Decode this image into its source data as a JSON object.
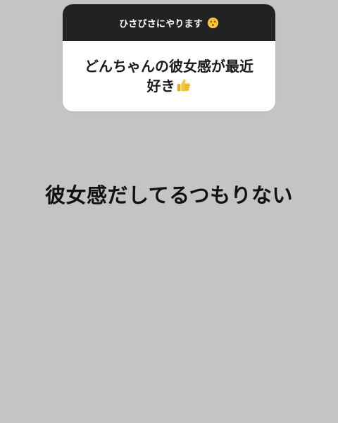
{
  "question_sticker": {
    "prompt": "ひさびさにやります",
    "prompt_emoji": "kissing-face-icon",
    "answer": "どんちゃんの彼女感が最近好き",
    "answer_emoji": "thumbs-up-icon"
  },
  "caption": "彼女感だしてるつもりない",
  "colors": {
    "background": "#c4c4c4",
    "sticker_header": "#222222",
    "sticker_body": "#ffffff",
    "emoji_yellow": "#f6c33a"
  }
}
